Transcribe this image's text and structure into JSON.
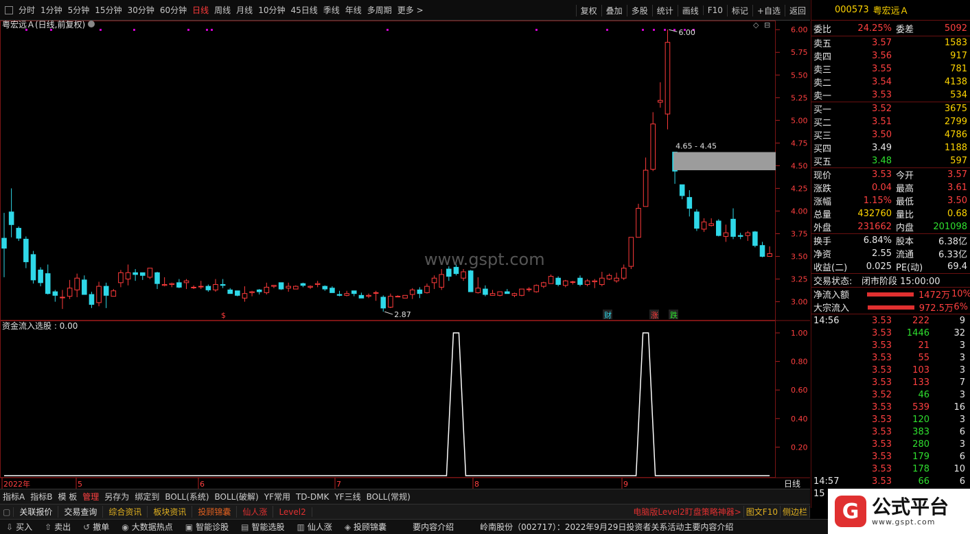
{
  "toolbar": {
    "periods": [
      "分时",
      "1分钟",
      "5分钟",
      "15分钟",
      "30分钟",
      "60分钟",
      "日线",
      "周线",
      "月线",
      "10分钟",
      "45日线",
      "季线",
      "年线",
      "多周期",
      "更多 >"
    ],
    "active": "日线",
    "right": [
      "复权",
      "叠加",
      "多股",
      "统计",
      "画线",
      "F10",
      "标记",
      "+自选",
      "返回"
    ]
  },
  "chart": {
    "title": "粤宏远Ａ(日线,前复权)",
    "indicator_title": "资金流入选股 : 0.00",
    "watermark": "www.gspt.com",
    "price_labels": [
      "6.00",
      "5.75",
      "5.50",
      "5.25",
      "5.00",
      "4.75",
      "4.50",
      "4.25",
      "4.00",
      "3.75",
      "3.50",
      "3.25",
      "3.00"
    ],
    "ind_labels": [
      "1.00",
      "0.80",
      "0.60",
      "0.40",
      "0.20"
    ],
    "high_label": "6.00",
    "low_label": "2.87",
    "gap_label": "4.65 - 4.45",
    "months": [
      "2022年",
      "5",
      "6",
      "7",
      "8",
      "9"
    ],
    "period_label": "日线",
    "tags": [
      "$",
      "财",
      "涨",
      "跌"
    ],
    "plus": "+",
    "close": "×",
    "candles": [
      [
        3.7,
        3.59,
        3.98,
        3.27
      ],
      [
        3.99,
        3.85,
        4.25,
        3.71
      ],
      [
        3.81,
        3.7,
        3.83,
        3.67
      ],
      [
        3.69,
        3.44,
        3.72,
        3.37
      ],
      [
        3.52,
        3.24,
        3.56,
        3.2
      ],
      [
        3.35,
        3.21,
        3.38,
        3.17
      ],
      [
        3.31,
        3.09,
        3.41,
        3.08
      ],
      [
        3.11,
        3.07,
        3.13,
        3.0
      ],
      [
        3.05,
        3.05,
        3.13,
        2.92
      ],
      [
        3.06,
        3.15,
        3.24,
        3.03
      ],
      [
        3.13,
        3.26,
        3.31,
        3.05
      ],
      [
        3.24,
        3.08,
        3.29,
        3.08
      ],
      [
        3.08,
        2.97,
        3.11,
        2.93
      ],
      [
        2.99,
        3.17,
        3.22,
        2.95
      ],
      [
        3.17,
        3.07,
        3.21,
        2.93
      ],
      [
        3.06,
        3.12,
        3.14,
        3.09
      ],
      [
        3.21,
        3.32,
        3.35,
        3.16
      ],
      [
        3.25,
        3.32,
        3.41,
        3.18
      ],
      [
        3.32,
        3.3,
        3.36,
        3.23
      ],
      [
        3.32,
        3.29,
        3.31,
        3.24
      ],
      [
        3.27,
        3.37,
        3.37,
        3.25
      ],
      [
        3.32,
        3.2,
        3.33,
        3.14
      ],
      [
        3.18,
        3.19,
        3.27,
        3.17
      ],
      [
        3.19,
        3.2,
        3.21,
        3.16
      ],
      [
        3.21,
        3.16,
        3.25,
        3.15
      ],
      [
        3.21,
        3.23,
        3.25,
        3.14
      ],
      [
        3.16,
        3.16,
        3.18,
        3.14
      ],
      [
        3.17,
        3.17,
        3.23,
        3.14
      ],
      [
        3.17,
        3.13,
        3.19,
        3.11
      ],
      [
        3.13,
        3.19,
        3.25,
        3.11
      ],
      [
        3.19,
        3.18,
        3.25,
        3.15
      ],
      [
        3.13,
        3.09,
        3.15,
        3.09
      ],
      [
        3.12,
        3.07,
        3.12,
        3.06
      ],
      [
        3.04,
        3.09,
        3.17,
        3.0
      ],
      [
        3.1,
        3.11,
        3.12,
        3.06
      ],
      [
        3.13,
        3.11,
        3.14,
        3.08
      ],
      [
        3.1,
        3.16,
        3.21,
        3.08
      ],
      [
        3.17,
        3.18,
        3.18,
        3.15
      ],
      [
        3.21,
        3.14,
        3.21,
        3.13
      ],
      [
        3.15,
        3.17,
        3.21,
        3.11
      ],
      [
        3.14,
        3.17,
        3.18,
        3.14
      ],
      [
        3.2,
        3.18,
        3.21,
        3.16
      ],
      [
        3.16,
        3.17,
        3.18,
        3.14
      ],
      [
        3.19,
        3.2,
        3.23,
        3.16
      ],
      [
        3.17,
        3.14,
        3.18,
        3.12
      ],
      [
        3.15,
        3.1,
        3.17,
        3.1
      ],
      [
        3.08,
        3.07,
        3.12,
        3.06
      ],
      [
        3.07,
        3.09,
        3.12,
        3.06
      ],
      [
        3.12,
        3.09,
        3.12,
        3.06
      ],
      [
        3.07,
        3.04,
        3.1,
        3.04
      ],
      [
        3.06,
        3.07,
        3.09,
        3.04
      ],
      [
        3.1,
        3.1,
        3.12,
        3.01
      ],
      [
        3.05,
        2.93,
        3.07,
        2.89
      ],
      [
        2.94,
        3.06,
        3.09,
        2.93
      ],
      [
        3.06,
        3.06,
        3.07,
        3.05
      ],
      [
        3.04,
        3.07,
        3.07,
        3.04
      ],
      [
        3.08,
        3.13,
        3.15,
        3.03
      ],
      [
        3.13,
        3.09,
        3.16,
        3.04
      ],
      [
        3.1,
        3.17,
        3.2,
        3.09
      ],
      [
        3.21,
        3.26,
        3.29,
        3.14
      ],
      [
        3.16,
        3.3,
        3.36,
        3.13
      ],
      [
        3.36,
        3.28,
        3.39,
        3.23
      ],
      [
        3.38,
        3.31,
        3.41,
        3.29
      ],
      [
        3.26,
        3.33,
        3.36,
        3.23
      ],
      [
        3.34,
        3.11,
        3.35,
        3.11
      ],
      [
        3.1,
        3.15,
        3.27,
        3.09
      ],
      [
        3.14,
        3.08,
        3.18,
        3.06
      ],
      [
        3.07,
        3.09,
        3.13,
        3.07
      ],
      [
        3.07,
        3.11,
        3.11,
        3.06
      ],
      [
        3.11,
        3.09,
        3.14,
        3.09
      ],
      [
        3.07,
        3.09,
        3.1,
        3.05
      ],
      [
        3.07,
        3.14,
        3.14,
        3.06
      ],
      [
        3.14,
        3.14,
        3.16,
        3.11
      ],
      [
        3.11,
        3.18,
        3.19,
        3.1
      ],
      [
        3.17,
        3.21,
        3.22,
        3.15
      ],
      [
        3.2,
        3.28,
        3.3,
        3.2
      ],
      [
        3.26,
        3.19,
        3.28,
        3.17
      ],
      [
        3.18,
        3.23,
        3.24,
        3.16
      ],
      [
        3.22,
        3.22,
        3.23,
        3.19
      ],
      [
        3.26,
        3.19,
        3.29,
        3.17
      ],
      [
        3.19,
        3.23,
        3.25,
        3.17
      ],
      [
        3.22,
        3.23,
        3.25,
        3.15
      ],
      [
        3.19,
        3.26,
        3.33,
        3.17
      ],
      [
        3.25,
        3.29,
        3.31,
        3.24
      ],
      [
        3.23,
        3.26,
        3.32,
        3.21
      ],
      [
        3.26,
        3.37,
        3.41,
        3.24
      ],
      [
        3.39,
        3.71,
        3.71,
        3.36
      ],
      [
        3.71,
        4.03,
        4.08,
        3.71
      ],
      [
        4.05,
        4.45,
        4.59,
        4.11
      ],
      [
        4.46,
        4.96,
        5.09,
        4.44
      ],
      [
        5.2,
        5.22,
        5.42,
        5.14
      ],
      [
        5.07,
        5.86,
        6.0,
        4.9
      ],
      [
        4.65,
        4.44,
        4.65,
        4.3
      ],
      [
        4.29,
        4.17,
        4.22,
        4.13
      ],
      [
        4.15,
        4.03,
        4.23,
        3.94
      ],
      [
        3.99,
        3.81,
        4.02,
        3.78
      ],
      [
        3.8,
        3.88,
        3.92,
        3.77
      ],
      [
        3.84,
        3.86,
        3.92,
        3.83
      ],
      [
        3.89,
        3.73,
        3.91,
        3.72
      ],
      [
        3.72,
        3.76,
        3.85,
        3.66
      ],
      [
        3.91,
        3.72,
        4.03,
        3.69
      ],
      [
        3.73,
        3.72,
        3.76,
        3.69
      ],
      [
        3.73,
        3.76,
        3.78,
        3.67
      ],
      [
        3.77,
        3.62,
        3.78,
        3.6
      ],
      [
        3.62,
        3.5,
        3.66,
        3.49
      ],
      [
        3.5,
        3.53,
        3.61,
        3.5
      ]
    ],
    "signal_index": [
      62,
      88
    ]
  },
  "panel": {
    "code": "000573",
    "name": "粤宏远Ａ",
    "weibi": {
      "label": "委比",
      "value": "24.25%",
      "label2": "委差",
      "value2": "5092"
    },
    "sells": [
      [
        "卖五",
        "3.57",
        "1583"
      ],
      [
        "卖四",
        "3.56",
        "917"
      ],
      [
        "卖三",
        "3.55",
        "781"
      ],
      [
        "卖二",
        "3.54",
        "4138"
      ],
      [
        "卖一",
        "3.53",
        "534"
      ]
    ],
    "buys": [
      [
        "买一",
        "3.52",
        "3675"
      ],
      [
        "买二",
        "3.51",
        "2799"
      ],
      [
        "买三",
        "3.50",
        "4786"
      ],
      [
        "买四",
        "3.49",
        "1188"
      ],
      [
        "买五",
        "3.48",
        "597"
      ]
    ],
    "stats": [
      [
        "现价",
        "3.53",
        "今开",
        "3.57"
      ],
      [
        "涨跌",
        "0.04",
        "最高",
        "3.61"
      ],
      [
        "涨幅",
        "1.15%",
        "最低",
        "3.50"
      ],
      [
        "总量",
        "432760",
        "量比",
        "0.68"
      ],
      [
        "外盘",
        "231662",
        "内盘",
        "201098"
      ],
      [
        "换手",
        "6.84%",
        "股本",
        "6.38亿"
      ],
      [
        "净资",
        "2.55",
        "流通",
        "6.33亿"
      ],
      [
        "收益(二)",
        "0.025",
        "PE(动)",
        "69.4"
      ]
    ],
    "trade_status": {
      "label": "交易状态:",
      "value": "闭市阶段 15:00:00"
    },
    "flows": [
      [
        "净流入额",
        "1472万",
        "10%"
      ],
      [
        "大宗流入",
        "972.5万",
        "6%"
      ]
    ],
    "ticks": [
      [
        "14:56",
        "3.53",
        "222",
        "9"
      ],
      [
        "",
        "3.53",
        "1446",
        "32"
      ],
      [
        "",
        "3.53",
        "21",
        "3"
      ],
      [
        "",
        "3.53",
        "55",
        "3"
      ],
      [
        "",
        "3.53",
        "103",
        "3"
      ],
      [
        "",
        "3.53",
        "133",
        "7"
      ],
      [
        "",
        "3.52",
        "46",
        "3"
      ],
      [
        "",
        "3.53",
        "539",
        "16"
      ],
      [
        "",
        "3.53",
        "120",
        "3"
      ],
      [
        "",
        "3.53",
        "383",
        "6"
      ],
      [
        "",
        "3.53",
        "280",
        "3"
      ],
      [
        "",
        "3.53",
        "179",
        "6"
      ],
      [
        "",
        "3.53",
        "178",
        "10"
      ],
      [
        "14:57",
        "3.53",
        "66",
        "6"
      ],
      [
        "15",
        "3.53",
        "",
        ""
      ]
    ]
  },
  "tabs1": [
    "指标A",
    "指标B",
    "模 板",
    "管理",
    "另存为",
    "绑定到",
    "BOLL(系统)",
    "BOLL(破解)",
    "YF常用",
    "TD-DMK",
    "YF三线",
    "BOLL(常规)"
  ],
  "tabs2": [
    "关联报价",
    "交易查询",
    "综合资讯",
    "板块资讯",
    "投顾锦囊",
    "仙人涨",
    "Level2"
  ],
  "tabs2_right": [
    "电脑版Level2盯盘策略神器>",
    "图文F10",
    "侧边栏"
  ],
  "bottom": {
    "items": [
      "买入",
      "卖出",
      "撤单",
      "大数据热点",
      "智能诊股",
      "智能选股",
      "仙人涨",
      "投顾锦囊"
    ],
    "news1": "要内容介绍",
    "news2": "岭南股份（002717）：2022年9月29日投资者关系活动主要内容介绍"
  },
  "logo": {
    "title": "公式平台",
    "url": "www.gspt.com"
  }
}
